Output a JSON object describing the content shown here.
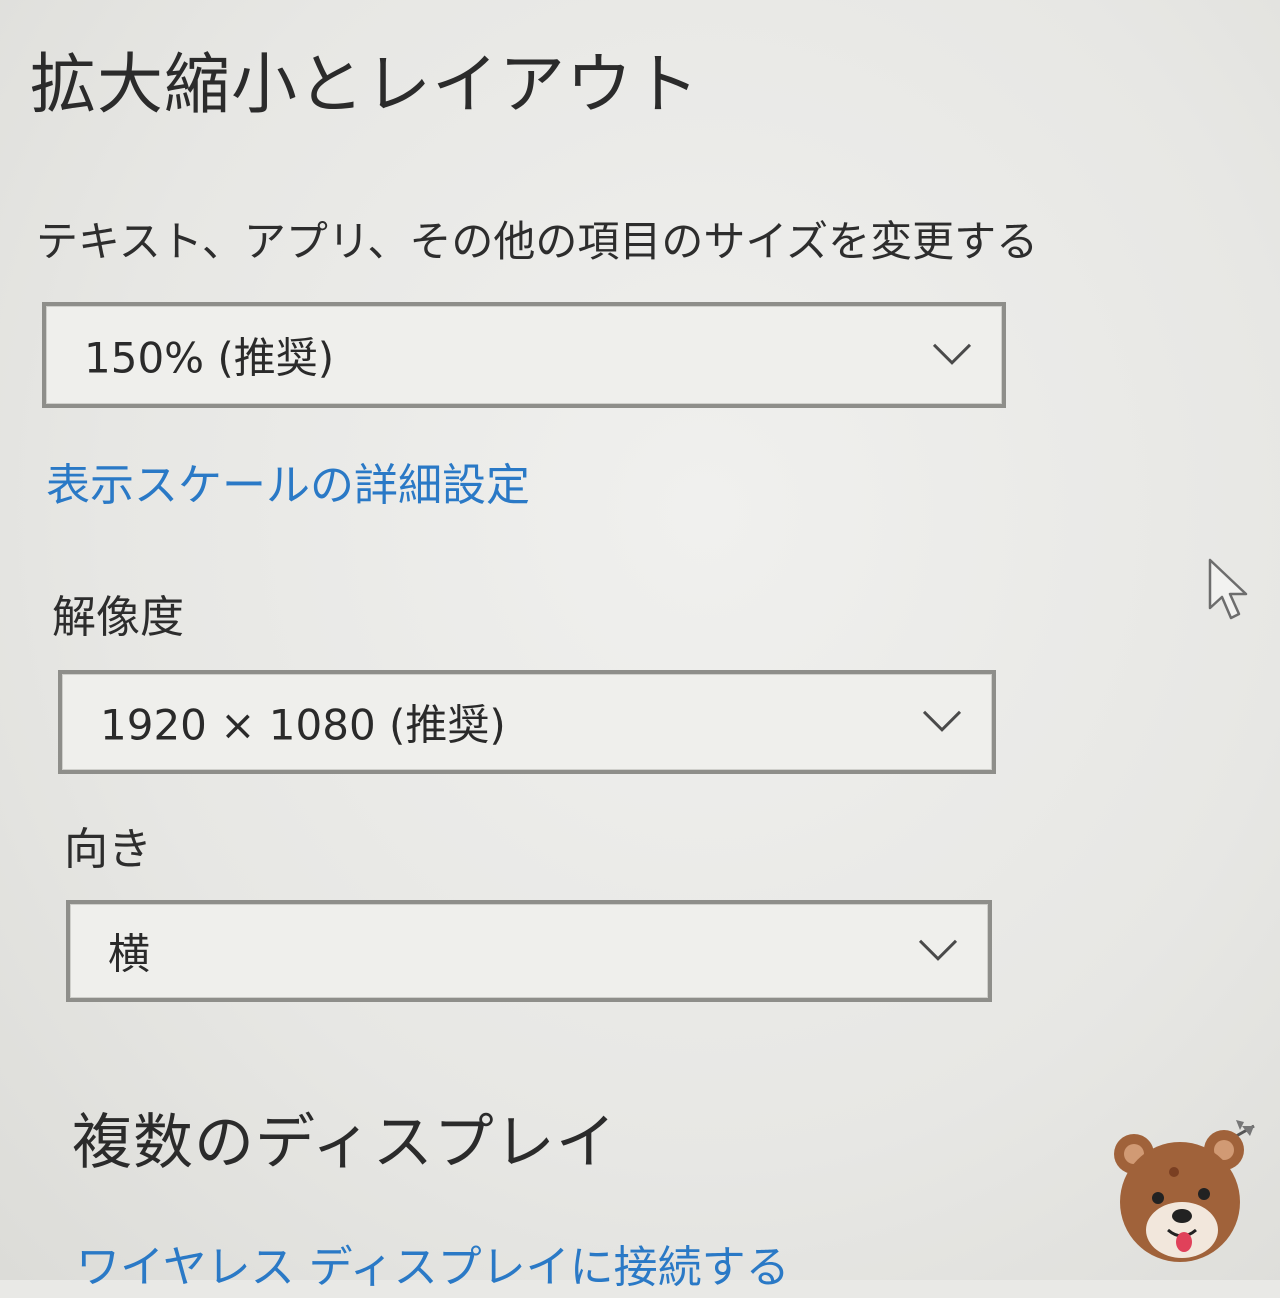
{
  "scale_layout": {
    "title": "拡大縮小とレイアウト",
    "text_size_label": "テキスト、アプリ、その他の項目のサイズを変更する",
    "text_size_value": "150% (推奨)",
    "advanced_scaling_link": "表示スケールの詳細設定",
    "resolution_label": "解像度",
    "resolution_value": "1920 × 1080 (推奨)",
    "orientation_label": "向き",
    "orientation_value": "横"
  },
  "multiple_displays": {
    "title": "複数のディスプレイ",
    "wireless_link": "ワイヤレス ディスプレイに接続する"
  },
  "icons": {
    "dropdown": "chevron-down-icon",
    "cursor": "mouse-pointer-icon",
    "watermark": "bear-mascot-icon"
  },
  "colors": {
    "link": "#2a79c6",
    "text": "#2d2d2d",
    "dropdown_border": "#8e8e8a"
  }
}
